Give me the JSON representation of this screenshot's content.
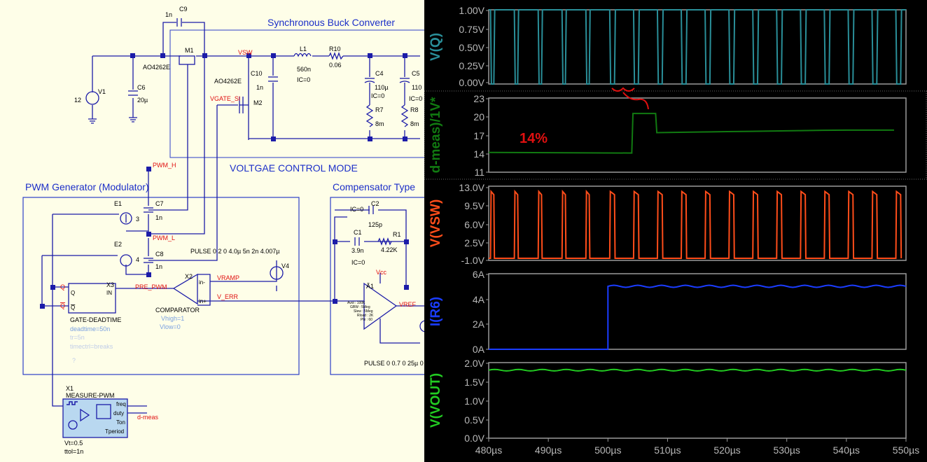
{
  "schematic": {
    "title_buck": "Synchronous Buck Converter",
    "title_mode": "VOLTGAE CONTROL MODE",
    "title_pwm": "PWM Generator (Modulator)",
    "title_comp": "Compensator Type",
    "m1_label": "M1",
    "m1_part": "AO4262E",
    "m2_label": "M2",
    "m2_part": "AO4262E",
    "c9_label": "C9",
    "c9_val": "1n",
    "v1_label": "V1",
    "v1_val": "12",
    "c6_label": "C6",
    "c6_val": "20µ",
    "net_vsw": "VSW",
    "net_vgate": "VGATE_SI",
    "c10_label": "C10",
    "c10_val": "1n",
    "l1_label": "L1",
    "l1_val": "560n",
    "l1_ic": "IC=0",
    "r10_label": "R10",
    "r10_val": "0.06",
    "c4_label": "C4",
    "c4_val": "110µ",
    "c4_ic": "IC=0",
    "c5_label": "C5",
    "c5_val": "110",
    "c5_ic": "IC=0",
    "r7_label": "R7",
    "r7_val": "8m",
    "r8_label": "R8",
    "r8_val": "8m",
    "net_pwm_h": "PWM_H",
    "net_pwm_l": "PWM_L",
    "e1_label": "E1",
    "e1_pin": "3",
    "e2_label": "E2",
    "e2_pin": "4",
    "c7_label": "C7",
    "c7_val": "1n",
    "c8_label": "C8",
    "c8_val": "1n",
    "pulse_v4": "PULSE 0 2 0 4.0µ 5n 2n 4.007µ",
    "v4_label": "V4",
    "x2_label": "X2",
    "net_vramp": "VRAMP",
    "net_verr": "V_ERR",
    "comp_in_neg": "in-",
    "comp_in_pos": "in+",
    "comparator_label": "COMPARATOR",
    "vhigh": "Vhigh=1",
    "vlow": "Vlow=0",
    "q_label": "Q",
    "qbar_label": "Q",
    "x3_label": "X3",
    "x3_in": "IN",
    "net_pre_pwm": "PRE_PWM",
    "gate_deadtime": "GATE-DEADTIME",
    "deadtime": "deadtime=50n",
    "tr": "tr=5n",
    "timectrl": "timectrl=breaks",
    "question": "?",
    "c2_ic": "IC=0",
    "c2_label": "C2",
    "c2_val": "125p",
    "c1_label": "C1",
    "c1_val": "3.9n",
    "c1_ic": "IC=0",
    "r1_label": "R1",
    "r1_val": "4.22K",
    "vcc": "Vcc",
    "a1_label": "Ã1",
    "net_vref": "VREF",
    "opamp_params": [
      "Avol : 100K",
      "GBW : 5Meg",
      "Slew : 5Meg",
      "Rload : 2K",
      "Phi : 60"
    ],
    "pulse_bottom": "PULSE 0 0.7 0 25µ 0",
    "x1_label": "X1",
    "x1_name": "MEASURE-PWM",
    "x1_freq": "freq",
    "x1_duty": "duty",
    "x1_ton": "Ton",
    "x1_tperiod": "Tperiod",
    "net_dmeas": "d-meas",
    "vt": "Vt=0.5",
    "ttol": "ttol=1n"
  },
  "waveforms": {
    "colors": {
      "vq": "#2a8f99",
      "dmeas": "#117a11",
      "vsw": "#ff4d1a",
      "ir6": "#1a3cff",
      "vout": "#22cc22",
      "annotation": "#e01010"
    },
    "annotation_text": "14%",
    "panels": [
      {
        "label": "V(Q)",
        "ticks": [
          "1.00V",
          "0.75V",
          "0.50V",
          "0.25V",
          "0.00V"
        ]
      },
      {
        "label": "d-meas)/1V*",
        "ticks": [
          "23",
          "20",
          "17",
          "14",
          "11"
        ]
      },
      {
        "label": "V(VSW)",
        "ticks": [
          "13.0V",
          "9.5V",
          "6.0V",
          "2.5V",
          "-1.0V"
        ]
      },
      {
        "label": "I(R6)",
        "ticks": [
          "6A",
          "4A",
          "2A",
          "0A"
        ]
      },
      {
        "label": "V(VOUT)",
        "ticks": [
          "2.0V",
          "1.5V",
          "1.0V",
          "0.5V",
          "0.0V"
        ]
      }
    ],
    "x_ticks": [
      "480µs",
      "490µs",
      "500µs",
      "510µs",
      "520µs",
      "530µs",
      "540µs",
      "550µs"
    ],
    "x_range": [
      480,
      550
    ],
    "switch_period_us": 4.0,
    "duty_before": 0.14,
    "step_time_us": 500,
    "dmeas_before": 14.2,
    "dmeas_peak": 20.5,
    "dmeas_after": 17.8,
    "vsw_high": 12.0,
    "vsw_low": -0.6,
    "ir6_before": 0.0,
    "ir6_after": 5.0,
    "vout_level": 1.8
  }
}
